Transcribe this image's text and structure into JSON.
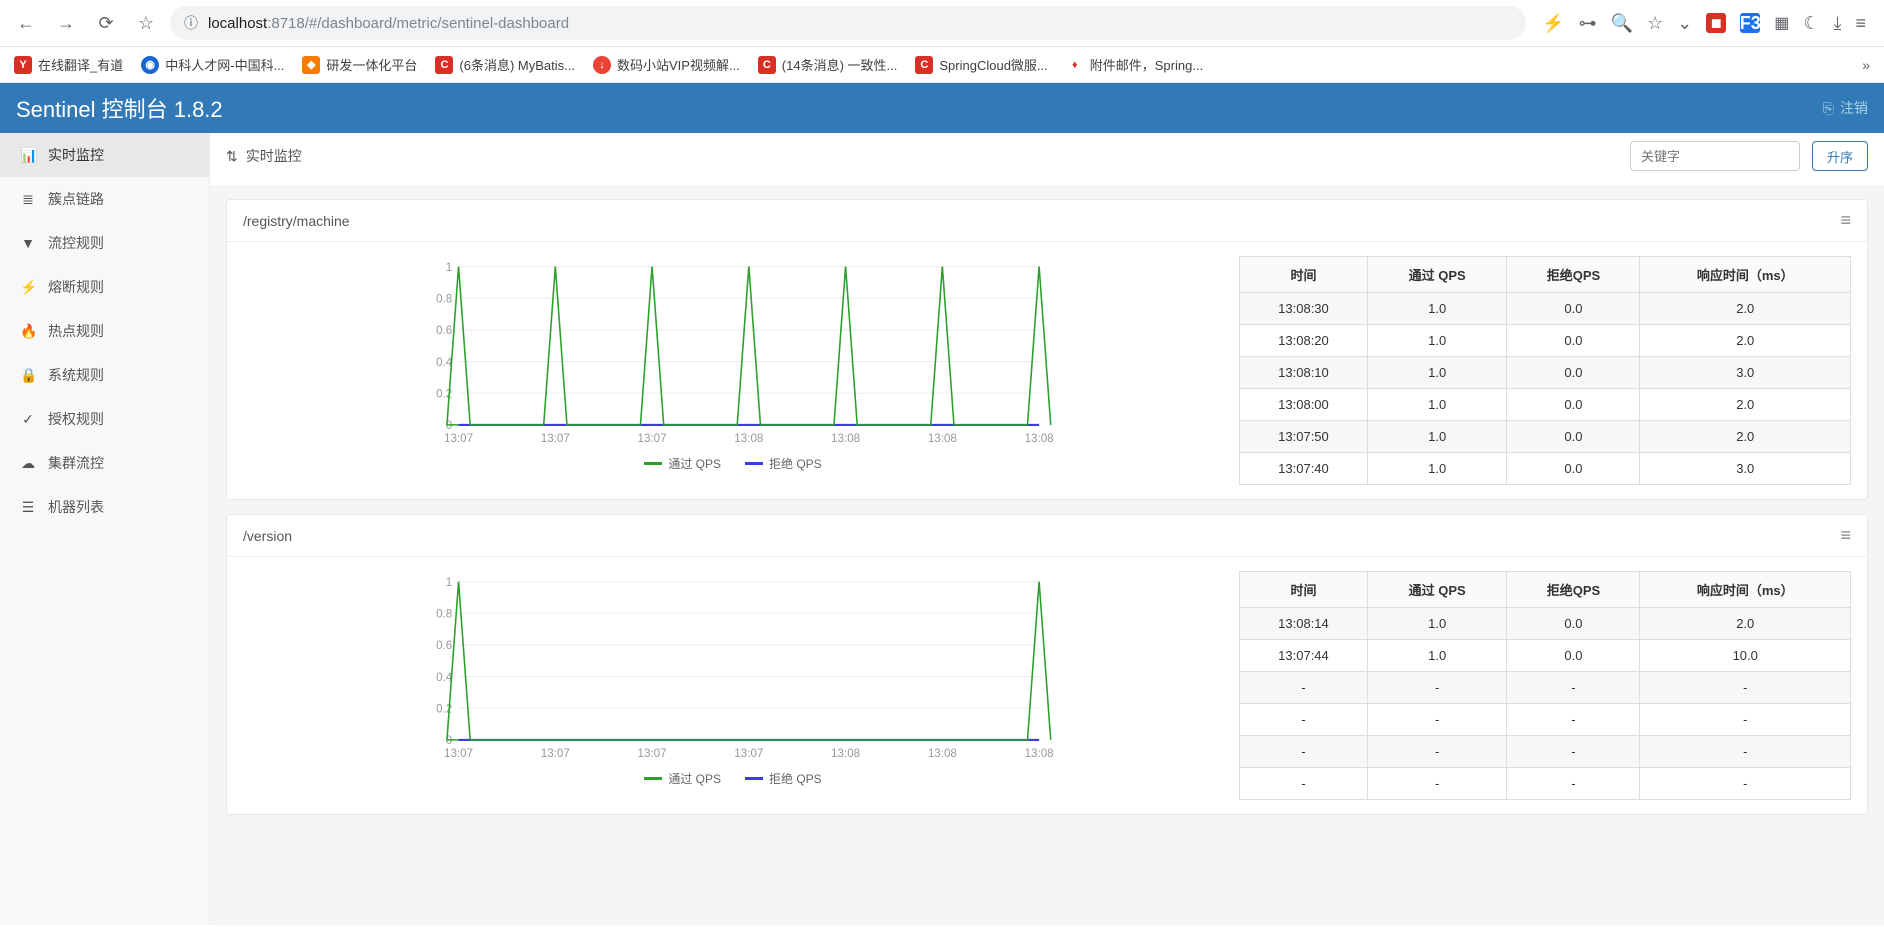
{
  "browser": {
    "url_host": "localhost",
    "url_port": ":8718",
    "url_path": "/#/dashboard/metric/sentinel-dashboard",
    "bookmarks": [
      {
        "icon": "y",
        "label": "在线翻译_有道"
      },
      {
        "icon": "globe",
        "label": "中科人才网-中国科..."
      },
      {
        "icon": "orange",
        "label": "研发一体化平台"
      },
      {
        "icon": "c",
        "label": "(6条消息) MyBatis..."
      },
      {
        "icon": "dl",
        "label": "数码小站VIP视频解..."
      },
      {
        "icon": "c",
        "label": "(14条消息) 一致性..."
      },
      {
        "icon": "c",
        "label": "SpringCloud微服..."
      },
      {
        "icon": "fire",
        "label": "附件邮件，Spring..."
      }
    ]
  },
  "app": {
    "title": "Sentinel 控制台 1.8.2",
    "logout": "注销"
  },
  "sidebar": {
    "items": [
      {
        "icon": "📊",
        "label": "实时监控"
      },
      {
        "icon": "≣",
        "label": "簇点链路"
      },
      {
        "icon": "▼",
        "label": "流控规则"
      },
      {
        "icon": "⚡",
        "label": "熔断规则"
      },
      {
        "icon": "🔥",
        "label": "热点规则"
      },
      {
        "icon": "🔒",
        "label": "系统规则"
      },
      {
        "icon": "✓",
        "label": "授权规则"
      },
      {
        "icon": "☁",
        "label": "集群流控"
      },
      {
        "icon": "☰",
        "label": "机器列表"
      }
    ]
  },
  "page": {
    "title": "实时监控",
    "search_placeholder": "关键字",
    "sort_label": "升序"
  },
  "panels": [
    {
      "title": "/registry/machine",
      "table_headers": [
        "时间",
        "通过 QPS",
        "拒绝QPS",
        "响应时间（ms）"
      ],
      "rows": [
        [
          "13:08:30",
          "1.0",
          "0.0",
          "2.0"
        ],
        [
          "13:08:20",
          "1.0",
          "0.0",
          "2.0"
        ],
        [
          "13:08:10",
          "1.0",
          "0.0",
          "3.0"
        ],
        [
          "13:08:00",
          "1.0",
          "0.0",
          "2.0"
        ],
        [
          "13:07:50",
          "1.0",
          "0.0",
          "2.0"
        ],
        [
          "13:07:40",
          "1.0",
          "0.0",
          "3.0"
        ]
      ],
      "legend": {
        "pass": "通过 QPS",
        "reject": "拒绝 QPS"
      },
      "chart_data": {
        "type": "line",
        "ylim": [
          0,
          1
        ],
        "yticks": [
          0,
          0.2,
          0.4,
          0.6,
          0.8,
          1
        ],
        "xlabels": [
          "13:07",
          "13:07",
          "13:07",
          "13:08",
          "13:08",
          "13:08",
          "13:08"
        ],
        "series": [
          {
            "name": "通过 QPS",
            "color": "#2ca02c",
            "spikes": [
              0,
              1,
              2,
              3,
              4,
              5,
              6
            ]
          },
          {
            "name": "拒绝 QPS",
            "color": "#3b3bde",
            "value": 0
          }
        ]
      }
    },
    {
      "title": "/version",
      "table_headers": [
        "时间",
        "通过 QPS",
        "拒绝QPS",
        "响应时间（ms）"
      ],
      "rows": [
        [
          "13:08:14",
          "1.0",
          "0.0",
          "2.0"
        ],
        [
          "13:07:44",
          "1.0",
          "0.0",
          "10.0"
        ],
        [
          "-",
          "-",
          "-",
          "-"
        ],
        [
          "-",
          "-",
          "-",
          "-"
        ],
        [
          "-",
          "-",
          "-",
          "-"
        ],
        [
          "-",
          "-",
          "-",
          "-"
        ]
      ],
      "legend": {
        "pass": "通过 QPS",
        "reject": "拒绝 QPS"
      },
      "chart_data": {
        "type": "line",
        "ylim": [
          0,
          1
        ],
        "yticks": [
          0,
          0.2,
          0.4,
          0.6,
          0.8,
          1
        ],
        "xlabels": [
          "13:07",
          "13:07",
          "13:07",
          "13:07",
          "13:08",
          "13:08",
          "13:08"
        ],
        "series": [
          {
            "name": "通过 QPS",
            "color": "#2ca02c",
            "spikes": [
              0,
              6
            ]
          },
          {
            "name": "拒绝 QPS",
            "color": "#3b3bde",
            "value": 0
          }
        ]
      }
    }
  ]
}
